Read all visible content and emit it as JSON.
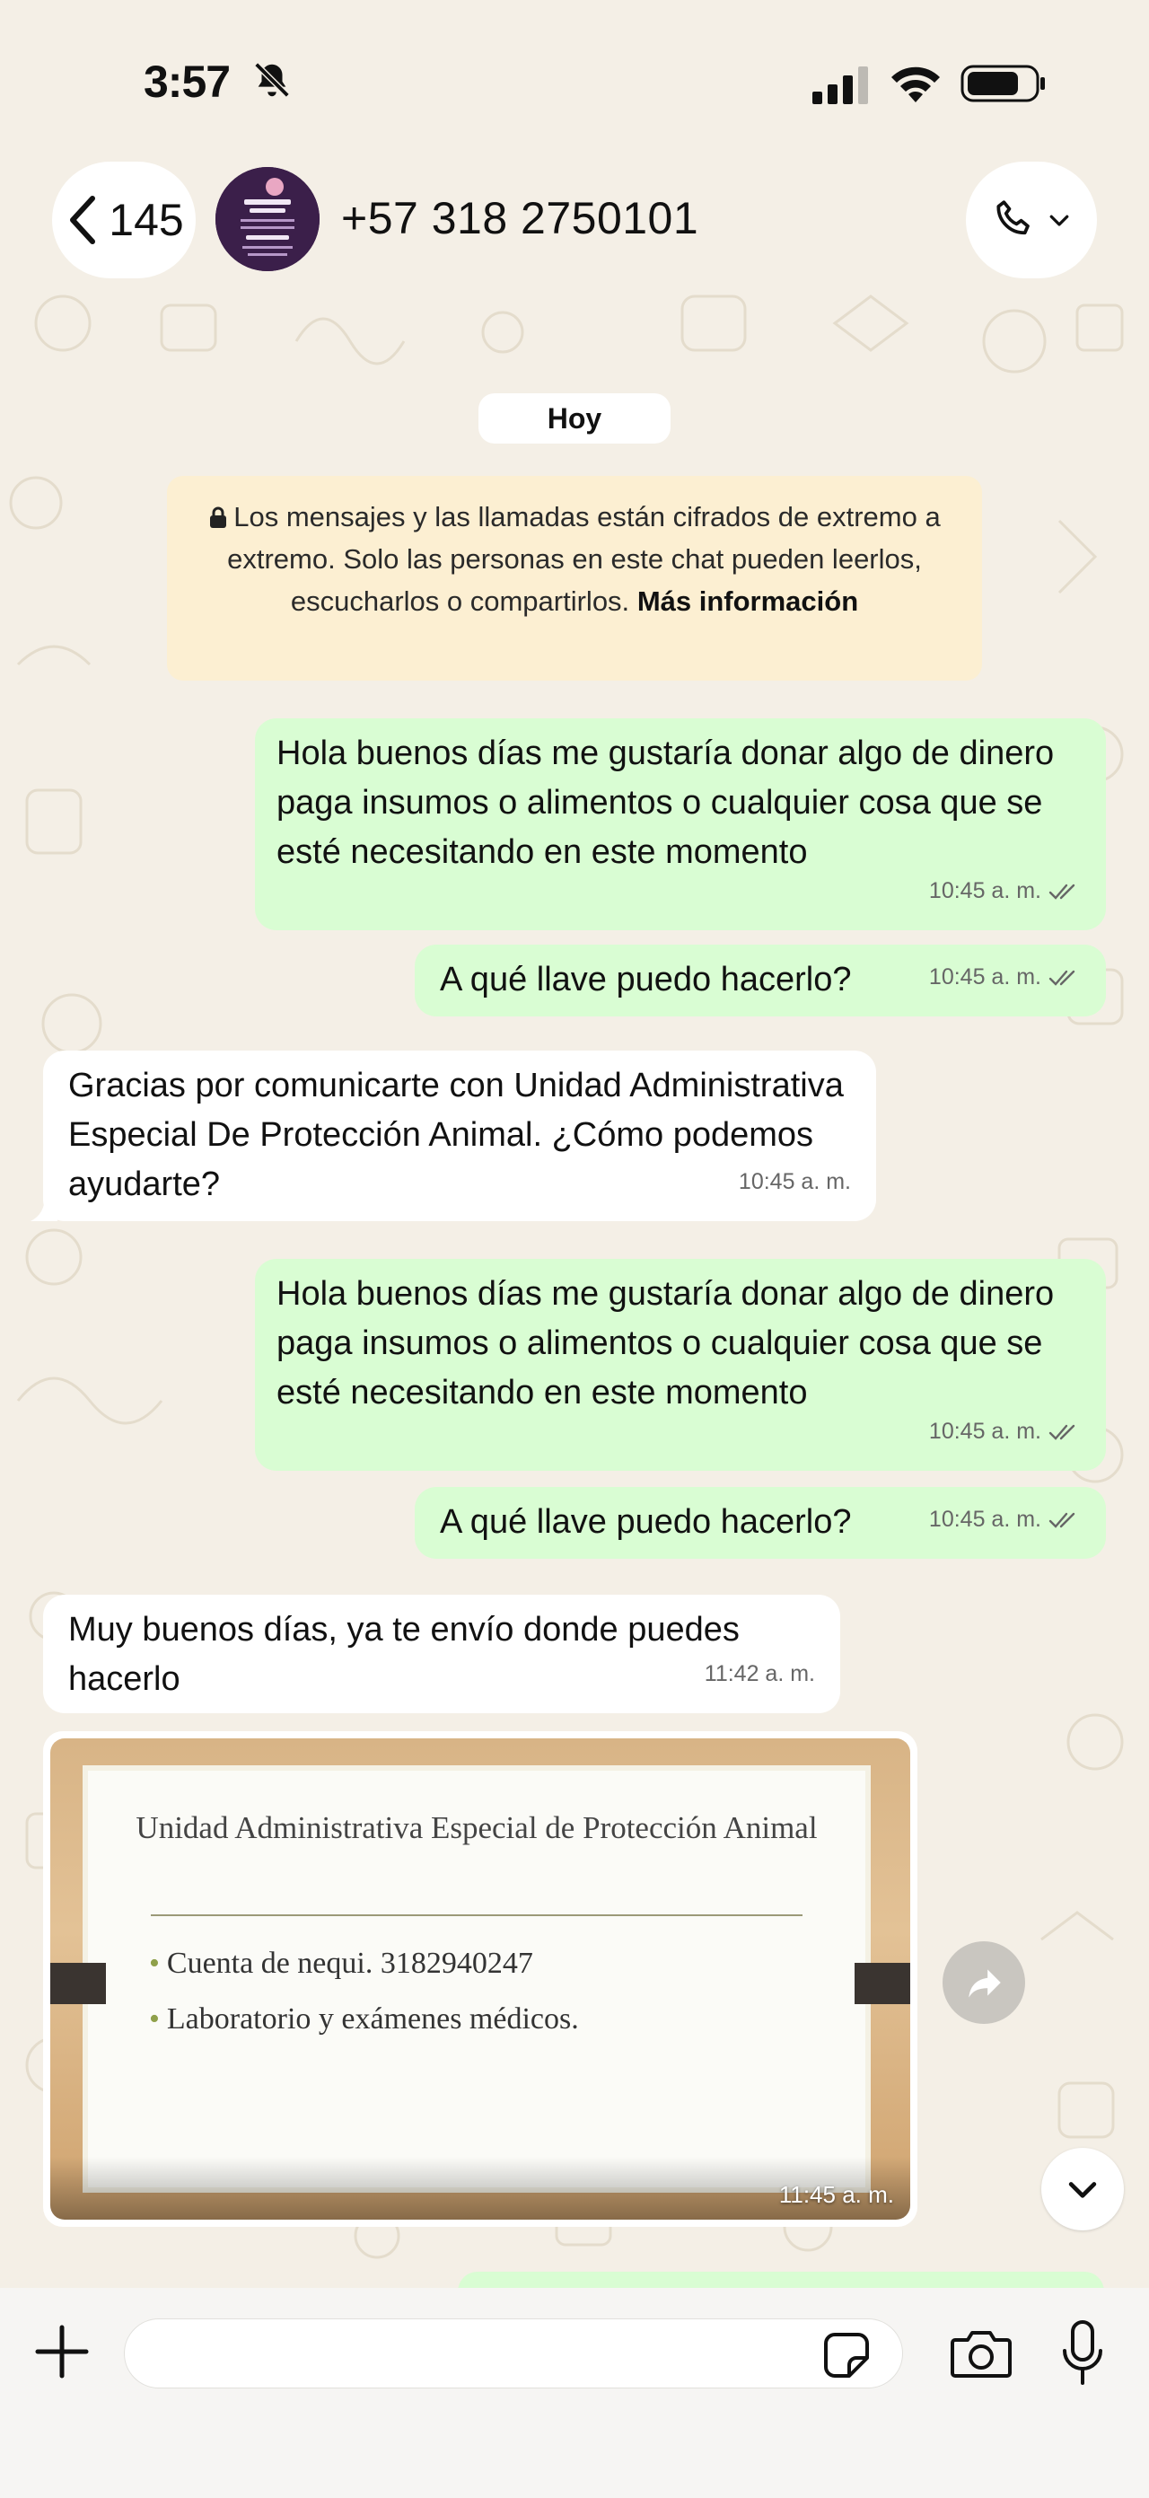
{
  "status_bar": {
    "time": "3:57"
  },
  "header": {
    "back_count": "145",
    "contact": "+57 318 2750101"
  },
  "chat": {
    "date_label": "Hoy",
    "encryption_notice": {
      "text": "Los mensajes y las llamadas están cifrados de extremo a extremo. Solo las personas en este chat pueden leerlos, escucharlos o compartirlos.",
      "link": "Más información"
    },
    "messages": [
      {
        "direction": "out",
        "text": "Hola buenos días me gustaría donar algo de dinero paga insumos o alimentos o cualquier cosa que se esté necesitando en este momento",
        "time": "10:45 a. m."
      },
      {
        "direction": "out",
        "text": "A qué llave puedo hacerlo?",
        "time": "10:45 a. m."
      },
      {
        "direction": "in",
        "text": "Gracias por comunicarte con Unidad Administrativa Especial De Protección Animal. ¿Cómo podemos ayudarte?",
        "time": "10:45 a. m."
      },
      {
        "direction": "out",
        "text": "Hola buenos días me gustaría donar algo de dinero paga insumos o alimentos o cualquier cosa que se esté necesitando en este momento",
        "time": "10:45 a. m."
      },
      {
        "direction": "out",
        "text": "A qué llave puedo hacerlo?",
        "time": "10:45 a. m."
      },
      {
        "direction": "in",
        "text": "Muy buenos días, ya te envío donde puedes hacerlo",
        "time": "11:42 a. m."
      }
    ],
    "image_message": {
      "title": "Unidad Administrativa Especial de Protección Animal",
      "items": [
        "Cuenta de nequi. 3182940247",
        "Laboratorio y exámenes médicos."
      ],
      "time": "11:45 a. m."
    }
  },
  "icons": {
    "back": "chevron-left-icon",
    "call": "phone-icon",
    "forward": "forward-icon",
    "scroll_down": "chevron-down-icon",
    "attach": "plus-icon",
    "sticker": "sticker-icon",
    "camera": "camera-icon",
    "mic": "microphone-icon"
  },
  "colors": {
    "outgoing": "#d9fdd3",
    "incoming": "#ffffff",
    "notice": "#fcefd2",
    "wallpaper": "#f4efe6",
    "read_ticks": "#53bdeb"
  }
}
